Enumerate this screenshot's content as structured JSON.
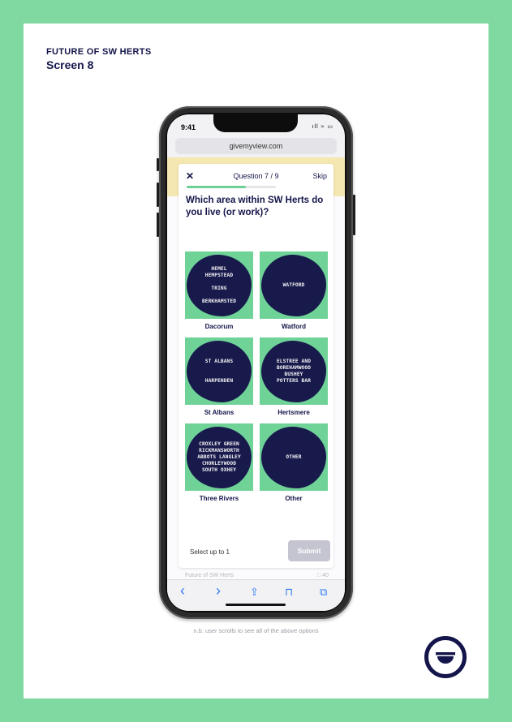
{
  "header": {
    "brand": "FUTURE OF SW HERTS",
    "screen": "Screen 8"
  },
  "phone": {
    "status_time": "9:41",
    "status_icons": "ıll ≈ ▭",
    "url": "givemyview.com"
  },
  "survey": {
    "close_label": "✕",
    "question_counter": "Question 7 / 9",
    "skip_label": "Skip",
    "progress": 0.667,
    "question": "Which area within SW Herts do you live (or work)?",
    "options": [
      {
        "label": "Dacorum",
        "tile_text": "HEMEL\nHEMPSTEAD\n\nTRING\n\nBERKHAMSTED"
      },
      {
        "label": "Watford",
        "tile_text": "WATFORD"
      },
      {
        "label": "St Albans",
        "tile_text": "ST ALBANS\n\n\nHARPENDEN"
      },
      {
        "label": "Hertsmere",
        "tile_text": "ELSTREE AND\nBOREHAMWOOD\nBUSHEY\nPOTTERS BAR"
      },
      {
        "label": "Three Rivers",
        "tile_text": "CROXLEY GREEN\nRICKMANSWORTH\nABBOTS LANGLEY\nCHORLEYWOOD\nSOUTH OXHEY"
      },
      {
        "label": "Other",
        "tile_text": "OTHER"
      }
    ],
    "select_hint": "Select up to 1",
    "submit_label": "Submit",
    "underlay_text": "Future of SW Herts",
    "underlay_count": "□ 40"
  },
  "toolbar": {
    "back": "‹",
    "forward": "›",
    "share": "⇪",
    "bookmarks": "⊓",
    "tabs": "⧉"
  },
  "note": "n.b. user scrolls to see all of the above options",
  "colors": {
    "background_green": "#7fd9a0",
    "navy": "#14154a",
    "tile_green": "#6fd398",
    "submit_disabled": "#c4c5d1",
    "ios_blue": "#2f7cf6"
  }
}
